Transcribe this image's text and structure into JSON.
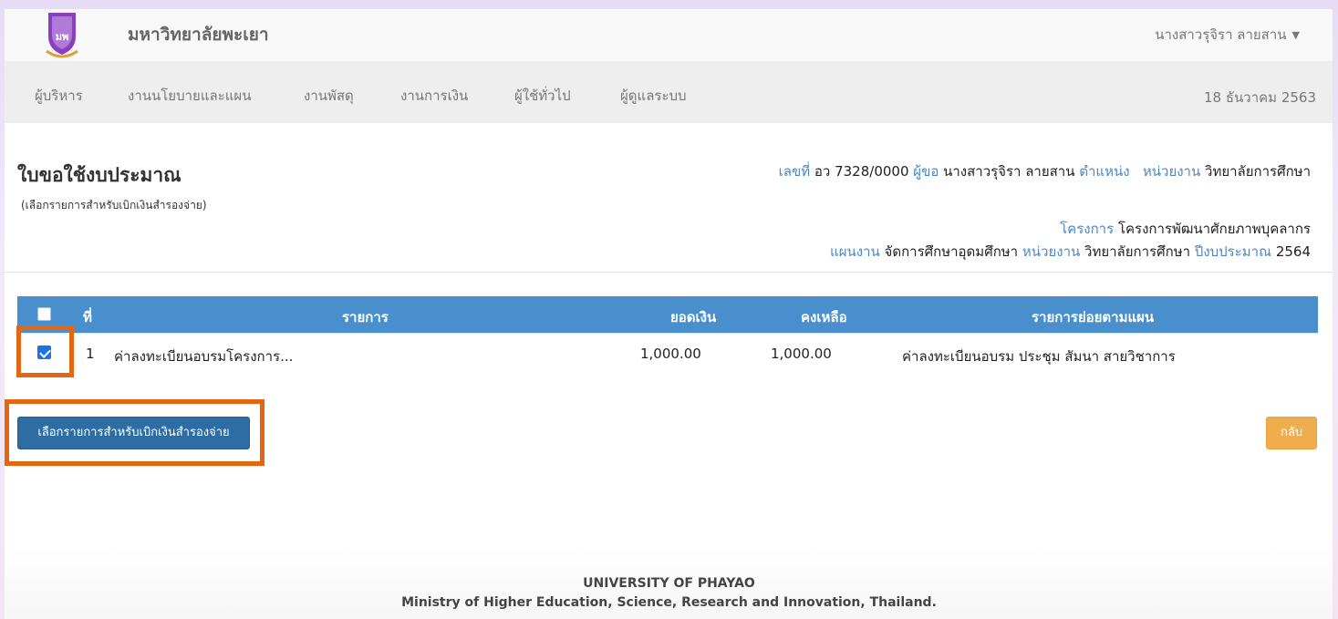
{
  "header": {
    "brand": "มหาวิทยาลัยพะเยา",
    "user": "นางสาวรุจิรา ลายสาน"
  },
  "nav": {
    "items": [
      "ผู้บริหาร",
      "งานนโยบายและแผน",
      "งานพัสดุ",
      "งานการเงิน",
      "ผู้ใช้ทั่วไป",
      "ผู้ดูแลระบบ"
    ],
    "date": "18 ธันวาคม 2563"
  },
  "page": {
    "title": "ใบขอใช้งบประมาณ",
    "subtitle": "(เลือกรายการสำหรับเบิกเงินสำรองจ่าย)"
  },
  "meta": {
    "doc_no_label": "เลขที่",
    "doc_no": "อว 7328/0000",
    "requester_label": "ผู้ขอ",
    "requester": "นางสาวรุจิรา ลายสาน",
    "position_label": "ตำแหน่ง",
    "unit_label": "หน่วยงาน",
    "unit": "วิทยาลัยการศึกษา",
    "project_label": "โครงการ",
    "project": "โครงการพัฒนาศักยภาพบุคลากร",
    "plan_label": "แผนงาน",
    "plan": "จัดการศึกษาอุดมศึกษา",
    "unit2_label": "หน่วยงาน",
    "unit2": "วิทยาลัยการศึกษา",
    "year_label": "ปีงบประมาณ",
    "year": "2564"
  },
  "table": {
    "headers": {
      "no": "ที่",
      "item": "รายการ",
      "amount": "ยอดเงิน",
      "remaining": "คงเหลือ",
      "subitem": "รายการย่อยตามแผน"
    },
    "rows": [
      {
        "checked": true,
        "no": "1",
        "item": "ค่าลงทะเบียนอบรมโครงการ...",
        "amount": "1,000.00",
        "remaining": "1,000.00",
        "subitem": "ค่าลงทะเบียนอบรม ประชุม สัมนา สายวิชาการ"
      }
    ]
  },
  "buttons": {
    "select_label": "เลือกรายการสำหรับเบิกเงินสำรองจ่าย",
    "back_label": "กลับ"
  },
  "footer": {
    "line1": "UNIVERSITY OF PHAYAO",
    "line2": "Ministry of Higher Education, Science, Research and Innovation, Thailand."
  },
  "colors": {
    "accent": "#4a8fcd",
    "primary_button": "#2e6da4",
    "back_button": "#f0ad4e",
    "highlight": "#e4660e",
    "label_blue": "#4a86c5"
  }
}
